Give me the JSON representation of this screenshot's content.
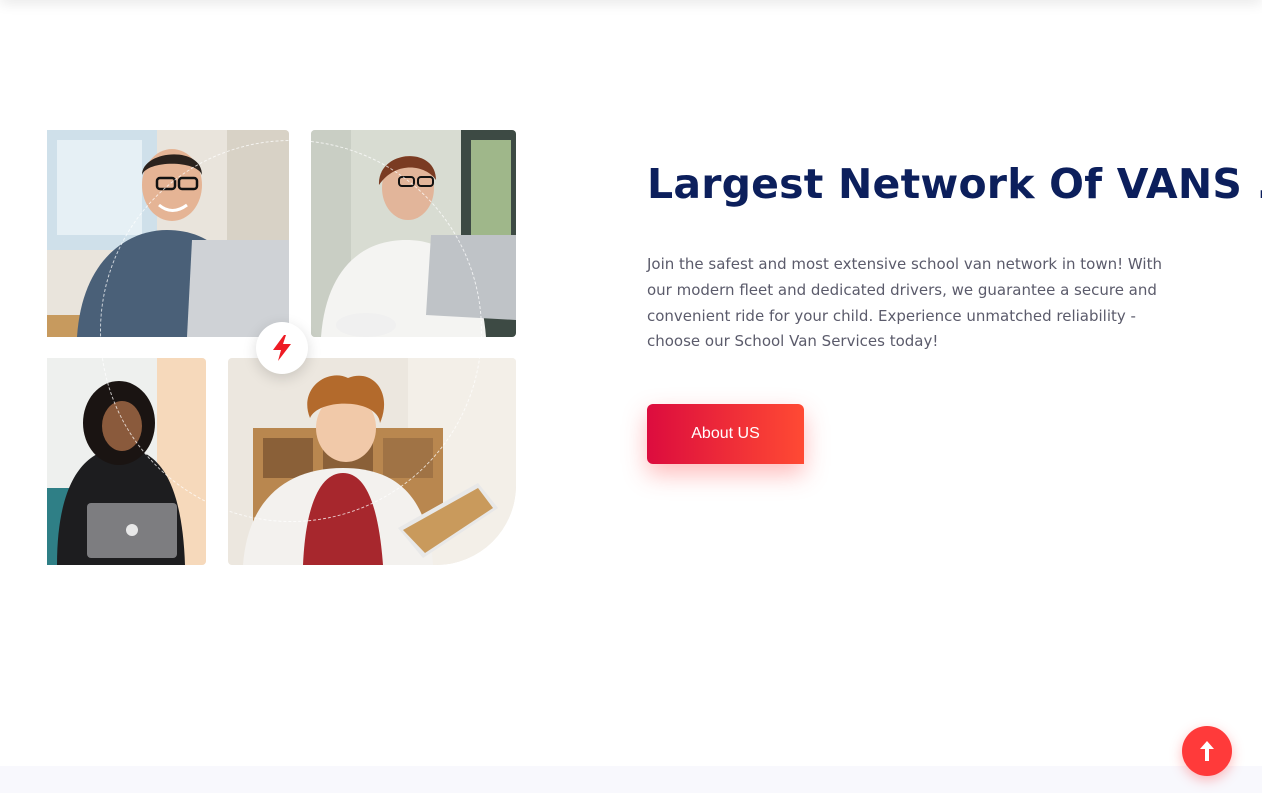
{
  "about_section": {
    "heading": "Largest Network Of VANS .",
    "description": "Join the safest and most extensive school van network in town! With our modern fleet and dedicated drivers, we guarantee a secure and convenient ride for your child. Experience unmatched reliability - choose our School Van Services today!",
    "cta_label": "About US",
    "badge_icon": "lightning-bolt-icon"
  },
  "gallery": {
    "photos": [
      "man-with-laptop-photo",
      "woman-with-laptop-photo",
      "woman-with-macbook-photo",
      "child-with-tablet-photo"
    ]
  },
  "scroll_top": {
    "icon": "arrow-up-icon"
  },
  "colors": {
    "heading": "#0c1f5c",
    "body_text": "#5b5b6b",
    "accent_start": "#dc0c3e",
    "accent_end": "#ff4a33",
    "scroll_top": "#ff3a3a"
  }
}
